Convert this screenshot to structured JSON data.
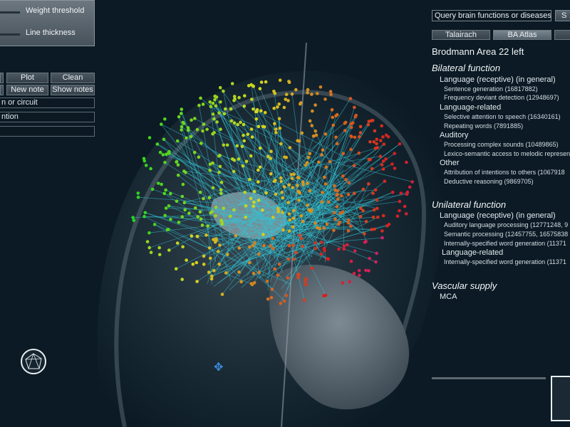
{
  "sliders": [
    {
      "label": "Weight threshold"
    },
    {
      "label": "Line thickness"
    }
  ],
  "toolbar": {
    "plot_label": "Plot",
    "clean_label": "Clean",
    "new_note_label": "New note",
    "show_notes_label": "Show notes"
  },
  "left_fields": [
    {
      "value": "n or circuit"
    },
    {
      "value": "ntion"
    },
    {
      "value": ""
    }
  ],
  "search": {
    "placeholder": "Query brain functions or diseases",
    "button_label": "S"
  },
  "atlas_tabs": [
    {
      "label": "Talairach"
    },
    {
      "label": "BA Atlas"
    }
  ],
  "area_title": "Brodmann Area 22 left",
  "sections": {
    "bilateral": {
      "title": "Bilateral function",
      "categories": [
        {
          "name": "Language (receptive) (in general)",
          "items": [
            "Sentence generation (16817882)",
            "Frequency deviant detection (12948697)"
          ]
        },
        {
          "name": "Language-related",
          "items": [
            "Selective attention to speech (16340161)",
            "Repeating words (7891885)"
          ]
        },
        {
          "name": "Auditory",
          "items": [
            "Processing complex sounds (10489865)",
            "Lexico-semantic access to melodic represen"
          ]
        },
        {
          "name": "Other",
          "items": [
            "Attribution of intentions to others (1067918",
            "Deductive reasoning (9869705)"
          ]
        }
      ]
    },
    "unilateral": {
      "title": "Unilateral function",
      "categories": [
        {
          "name": "Language (receptive) (in general)",
          "items": [
            "Auditory language processing (12771248, 9",
            "Semantic processing (12457755, 16575838",
            "Internally-specified word generation (11371"
          ]
        },
        {
          "name": "Language-related",
          "items": [
            "Internally-specified word generation (11371"
          ]
        }
      ]
    },
    "vascular": {
      "title": "Vascular supply",
      "value": "MCA"
    }
  },
  "colors": {
    "connection": "#33c4d4",
    "background": "#0b1a24"
  }
}
